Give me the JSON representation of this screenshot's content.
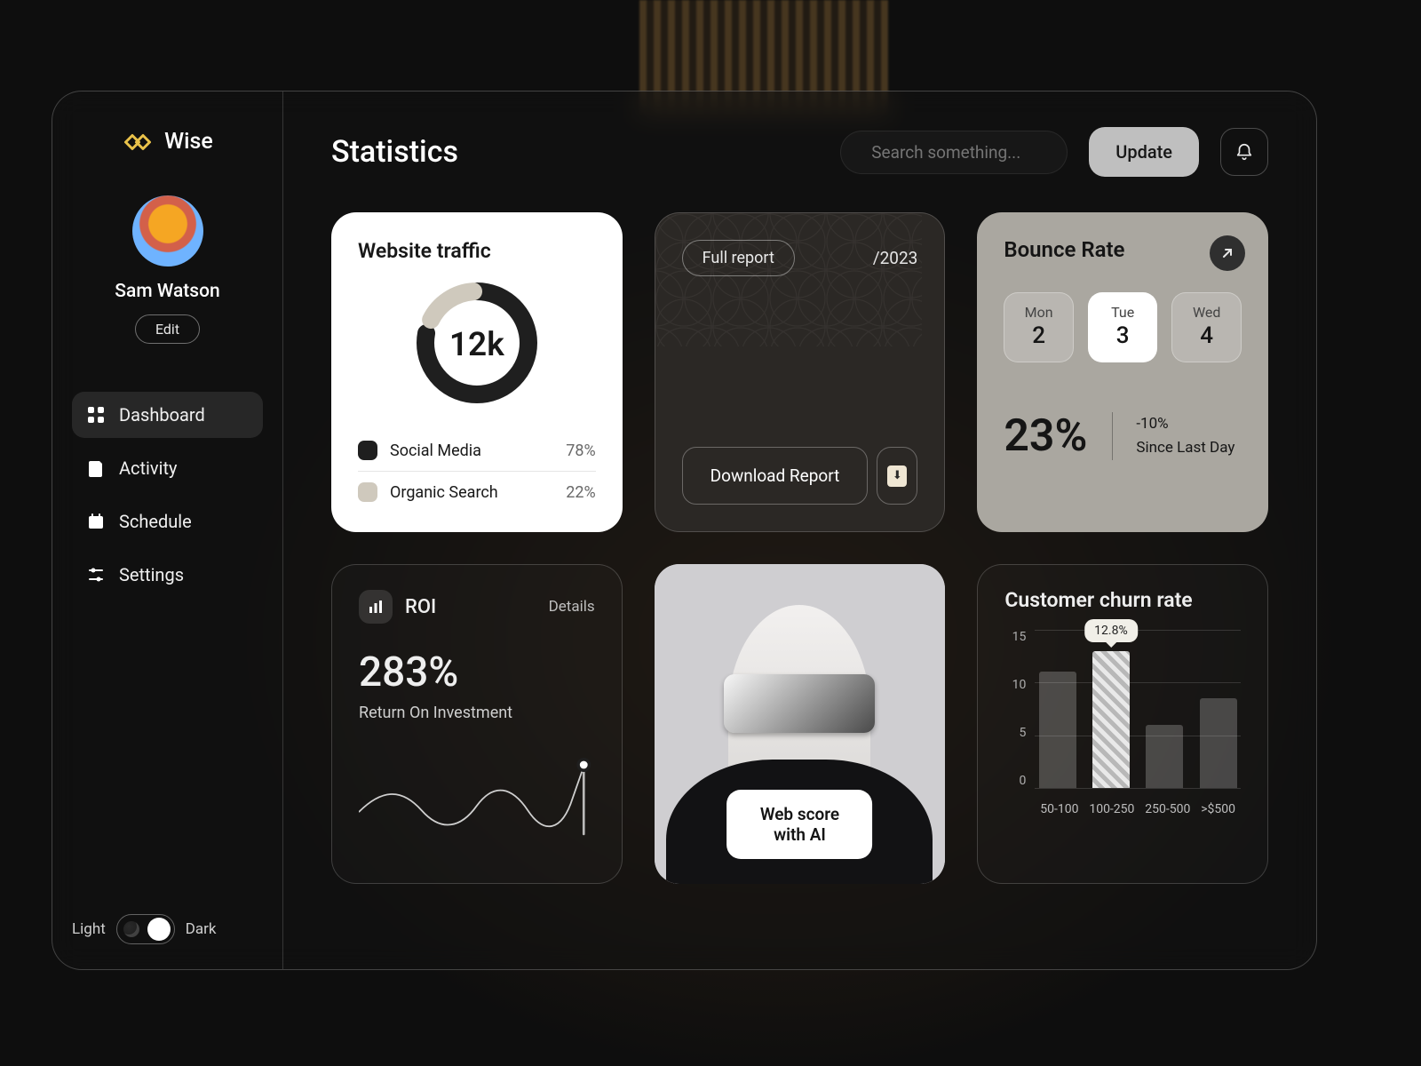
{
  "brand": {
    "name": "Wise"
  },
  "user": {
    "name": "Sam Watson",
    "edit_label": "Edit"
  },
  "nav": {
    "items": [
      {
        "label": "Dashboard"
      },
      {
        "label": "Activity"
      },
      {
        "label": "Schedule"
      },
      {
        "label": "Settings"
      }
    ]
  },
  "theme": {
    "light_label": "Light",
    "dark_label": "Dark"
  },
  "header": {
    "title": "Statistics",
    "search_placeholder": "Search something...",
    "update_label": "Update"
  },
  "traffic": {
    "title": "Website traffic",
    "center_value": "12k",
    "legend": [
      {
        "label": "Social Media",
        "value": "78%",
        "color": "#1f1f1f"
      },
      {
        "label": "Organic Search",
        "value": "22%",
        "color": "#cfc9bd"
      }
    ]
  },
  "report": {
    "pill_label": "Full report",
    "year": "/2023",
    "download_label": "Download Report"
  },
  "bounce": {
    "title": "Bounce Rate",
    "days": [
      {
        "label": "Mon",
        "num": "2"
      },
      {
        "label": "Tue",
        "num": "3"
      },
      {
        "label": "Wed",
        "num": "4"
      }
    ],
    "value": "23%",
    "delta": "-10%",
    "since": "Since Last Day"
  },
  "roi": {
    "title": "ROI",
    "details_label": "Details",
    "value": "283%",
    "subtitle": "Return On Investment"
  },
  "ai": {
    "button_label": "Web score with AI"
  },
  "churn": {
    "title": "Customer churn rate",
    "tooltip_value": "12.8%"
  },
  "chart_data": [
    {
      "type": "pie",
      "title": "Website traffic",
      "categories": [
        "Social Media",
        "Organic Search"
      ],
      "values": [
        78,
        22
      ],
      "total_label": "12k"
    },
    {
      "type": "bar",
      "title": "Customer churn rate",
      "categories": [
        "50-100",
        "100-250",
        "250-500",
        ">$500"
      ],
      "values": [
        11,
        13,
        6,
        8.5
      ],
      "ylim": [
        0,
        15
      ],
      "yticks": [
        0,
        5,
        10,
        15
      ],
      "highlight_index": 1,
      "highlight_label": "12.8%"
    }
  ]
}
